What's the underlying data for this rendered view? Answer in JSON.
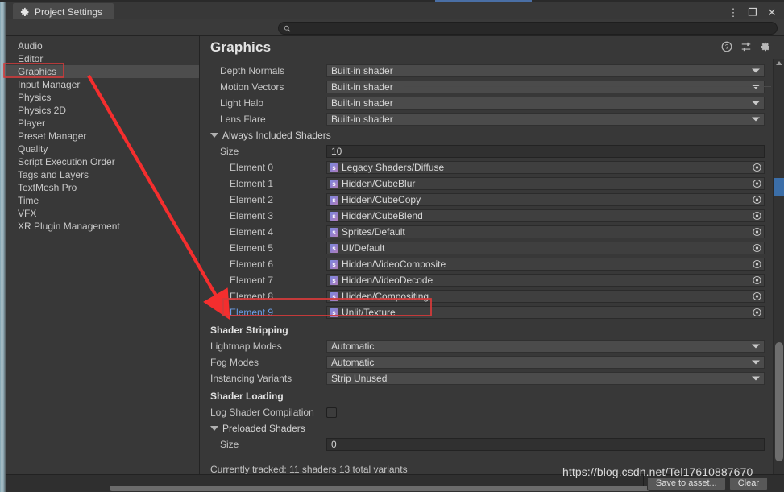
{
  "window": {
    "tab_label": "Project Settings",
    "tab_icon": "gear-icon",
    "controls": {
      "menu": "⋮",
      "maximize": "❐",
      "close": "✕"
    }
  },
  "toolbar": {
    "search_placeholder": "",
    "search_value": "",
    "search_icon": "search-icon"
  },
  "sidebar": {
    "items": [
      {
        "label": "Audio",
        "selected": false
      },
      {
        "label": "Editor",
        "selected": false
      },
      {
        "label": "Graphics",
        "selected": true
      },
      {
        "label": "Input Manager",
        "selected": false
      },
      {
        "label": "Physics",
        "selected": false
      },
      {
        "label": "Physics 2D",
        "selected": false
      },
      {
        "label": "Player",
        "selected": false
      },
      {
        "label": "Preset Manager",
        "selected": false
      },
      {
        "label": "Quality",
        "selected": false
      },
      {
        "label": "Script Execution Order",
        "selected": false
      },
      {
        "label": "Tags and Layers",
        "selected": false
      },
      {
        "label": "TextMesh Pro",
        "selected": false
      },
      {
        "label": "Time",
        "selected": false
      },
      {
        "label": "VFX",
        "selected": false
      },
      {
        "label": "XR Plugin Management",
        "selected": false
      }
    ]
  },
  "panel": {
    "title": "Graphics",
    "header_icons": [
      "help-icon",
      "preset-icon",
      "gear-icon"
    ],
    "builtin_shader_rows": [
      {
        "label": "Depth Normals",
        "value": "Built-in shader"
      },
      {
        "label": "Motion Vectors",
        "value": "Built-in shader"
      },
      {
        "label": "Light Halo",
        "value": "Built-in shader"
      },
      {
        "label": "Lens Flare",
        "value": "Built-in shader"
      }
    ],
    "always_included": {
      "foldout_label": "Always Included Shaders",
      "size_label": "Size",
      "size_value": "10",
      "elements": [
        {
          "label": "Element 0",
          "value": "Legacy Shaders/Diffuse",
          "highlighted": false
        },
        {
          "label": "Element 1",
          "value": "Hidden/CubeBlur",
          "highlighted": false
        },
        {
          "label": "Element 2",
          "value": "Hidden/CubeCopy",
          "highlighted": false
        },
        {
          "label": "Element 3",
          "value": "Hidden/CubeBlend",
          "highlighted": false
        },
        {
          "label": "Element 4",
          "value": "Sprites/Default",
          "highlighted": false
        },
        {
          "label": "Element 5",
          "value": "UI/Default",
          "highlighted": false
        },
        {
          "label": "Element 6",
          "value": "Hidden/VideoComposite",
          "highlighted": false
        },
        {
          "label": "Element 7",
          "value": "Hidden/VideoDecode",
          "highlighted": false
        },
        {
          "label": "Element 8",
          "value": "Hidden/Compositing",
          "highlighted": false
        },
        {
          "label": "Element 9",
          "value": "Unlit/Texture",
          "highlighted": true
        }
      ]
    },
    "shader_stripping": {
      "heading": "Shader Stripping",
      "rows": [
        {
          "label": "Lightmap Modes",
          "value": "Automatic"
        },
        {
          "label": "Fog Modes",
          "value": "Automatic"
        },
        {
          "label": "Instancing Variants",
          "value": "Strip Unused"
        }
      ]
    },
    "shader_loading": {
      "heading": "Shader Loading",
      "log_label": "Log Shader Compilation",
      "log_checked": false,
      "preloaded_foldout": "Preloaded Shaders",
      "preloaded_size_label": "Size",
      "preloaded_size_value": "0"
    },
    "status_text": "Currently tracked: 11 shaders 13 total variants"
  },
  "bottom": {
    "save_button": "Save to asset...",
    "clear_button": "Clear"
  },
  "annotations": {
    "watermark": "https://blog.csdn.net/Tel17610887670",
    "arrow_color": "#f42e2e",
    "box_color": "#d33a3a"
  }
}
